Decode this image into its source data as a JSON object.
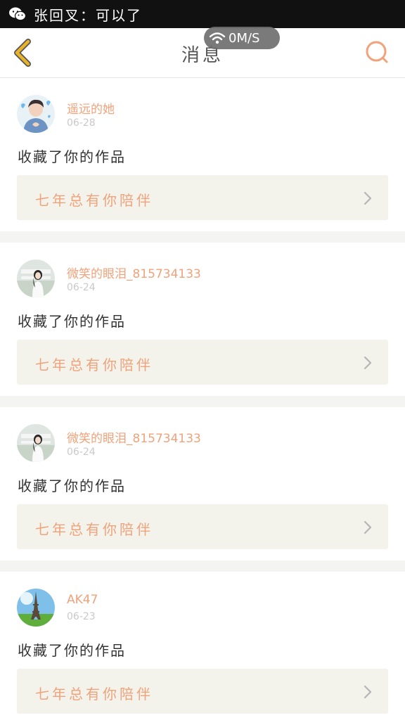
{
  "status_bar": {
    "notification_icon": "wechat-icon",
    "notification_text": "张回叉：可以了"
  },
  "header": {
    "title": "消息",
    "back_icon": "chevron-left-icon",
    "search_icon": "search-icon",
    "network_speed": "0M/S"
  },
  "colors": {
    "accent": "#f0a27a",
    "back_arrow": "#e9b22b",
    "card_background": "#f3f3ec",
    "separator": "#f4f4f2"
  },
  "messages": [
    {
      "username": "遥远的她",
      "date": "06-28",
      "action": "收藏了你的作品",
      "work_title": "七年总有你陪伴",
      "avatar": "avatar-boy-hearts"
    },
    {
      "username": "微笑的眼泪_815734133",
      "date": "06-24",
      "action": "收藏了你的作品",
      "work_title": "七年总有你陪伴",
      "avatar": "avatar-girl-outdoors"
    },
    {
      "username": "微笑的眼泪_815734133",
      "date": "06-24",
      "action": "收藏了你的作品",
      "work_title": "七年总有你陪伴",
      "avatar": "avatar-girl-outdoors"
    },
    {
      "username": "AK47",
      "date": "06-23",
      "action": "收藏了你的作品",
      "work_title": "七年总有你陪伴",
      "avatar": "avatar-eiffel-tower"
    }
  ]
}
